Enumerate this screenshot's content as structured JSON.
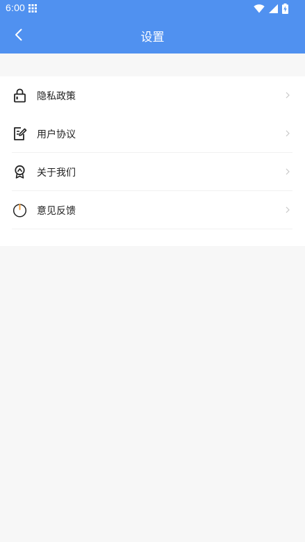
{
  "status_bar": {
    "time": "6:00"
  },
  "header": {
    "title": "设置",
    "background_color": "#5091f0"
  },
  "menu": {
    "items": [
      {
        "label": "隐私政策",
        "icon": "lock-icon"
      },
      {
        "label": "用户协议",
        "icon": "edit-document-icon"
      },
      {
        "label": "关于我们",
        "icon": "badge-icon"
      },
      {
        "label": "意见反馈",
        "icon": "power-icon"
      }
    ]
  }
}
